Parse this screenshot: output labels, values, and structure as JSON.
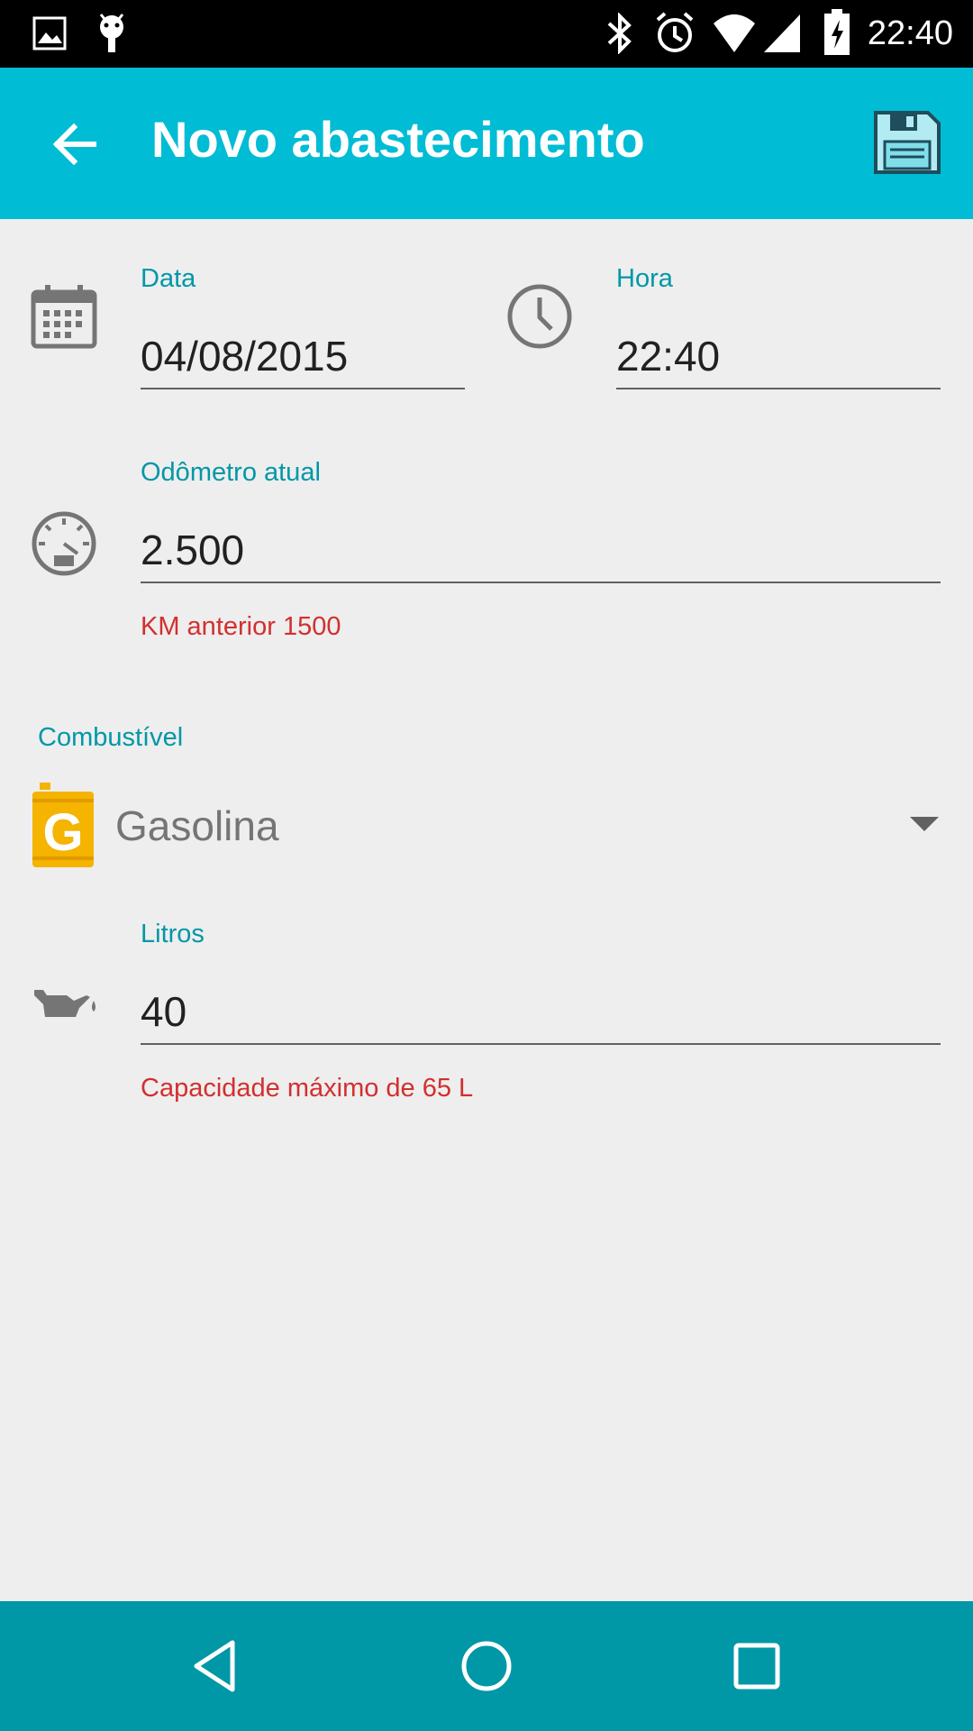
{
  "status_bar": {
    "time": "22:40",
    "icons": [
      "image-icon",
      "android-icon",
      "bluetooth-icon",
      "alarm-icon",
      "wifi-icon",
      "signal-icon",
      "battery-charging-icon"
    ]
  },
  "app_bar": {
    "title": "Novo abastecimento",
    "back_icon": "arrow-back-icon",
    "save_icon": "floppy-disk-icon",
    "accent_color": "#00bcd4"
  },
  "form": {
    "date": {
      "label": "Data",
      "value": "04/08/2015",
      "icon": "calendar-icon"
    },
    "time": {
      "label": "Hora",
      "value": "22:40",
      "icon": "clock-icon"
    },
    "odometer": {
      "label": "Odômetro atual",
      "value": "2.500",
      "helper": "KM anterior 1500",
      "icon": "speedometer-icon"
    },
    "fuel": {
      "label": "Combustível",
      "value": "Gasolina",
      "icon": "gasoline-can-icon",
      "icon_letter": "G"
    },
    "liters": {
      "label": "Litros",
      "value": "40",
      "helper": "Capacidade máximo de 65 L",
      "icon": "oil-can-icon"
    }
  },
  "colors": {
    "label": "#0097a7",
    "error": "#d32f2f",
    "fuel_icon": "#f4b400",
    "nav_bar": "#0097a7"
  },
  "nav_bar": {
    "buttons": [
      "back-triangle-icon",
      "home-circle-icon",
      "recents-square-icon"
    ]
  }
}
